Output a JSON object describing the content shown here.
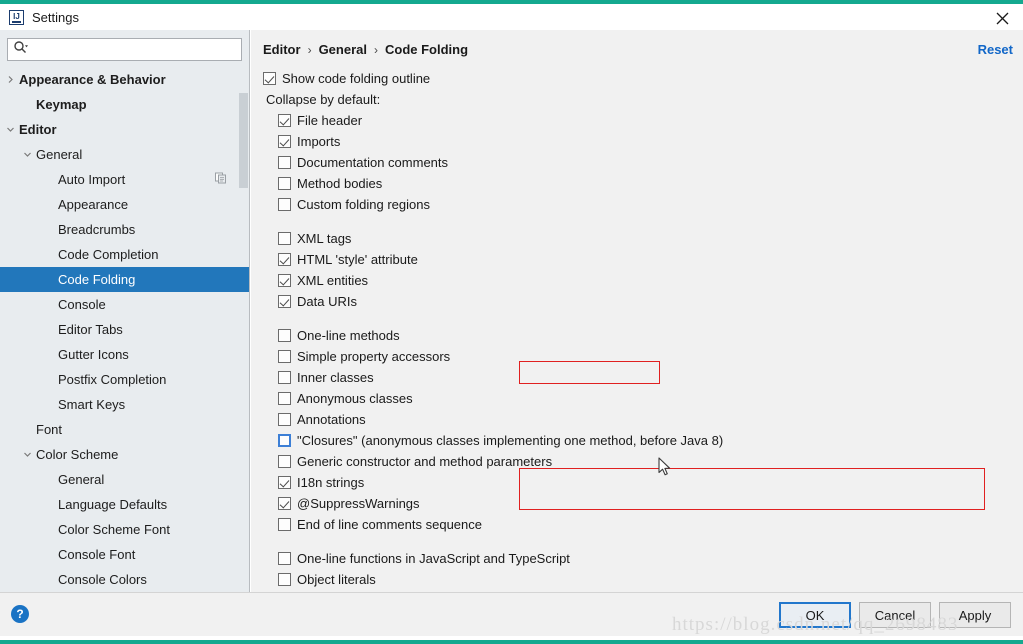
{
  "window": {
    "title": "Settings",
    "logo_icon": "intellij-idea-logo",
    "close_icon": "close-icon"
  },
  "sidebar": {
    "search": {
      "value": "",
      "placeholder": "",
      "icon": "search-icon"
    },
    "items": [
      {
        "label": "Appearance & Behavior",
        "depth": 0,
        "twisty": "chevron-right",
        "bold": true,
        "selected": false
      },
      {
        "label": "Keymap",
        "depth": 1,
        "twisty": "none",
        "bold": true,
        "selected": false
      },
      {
        "label": "Editor",
        "depth": 0,
        "twisty": "chevron-down",
        "bold": true,
        "selected": false
      },
      {
        "label": "General",
        "depth": 1,
        "twisty": "chevron-down",
        "bold": false,
        "selected": false
      },
      {
        "label": "Auto Import",
        "depth": 2,
        "twisty": "none",
        "bold": false,
        "selected": false,
        "badge": "copy-icon"
      },
      {
        "label": "Appearance",
        "depth": 2,
        "twisty": "none",
        "bold": false,
        "selected": false
      },
      {
        "label": "Breadcrumbs",
        "depth": 2,
        "twisty": "none",
        "bold": false,
        "selected": false
      },
      {
        "label": "Code Completion",
        "depth": 2,
        "twisty": "none",
        "bold": false,
        "selected": false
      },
      {
        "label": "Code Folding",
        "depth": 2,
        "twisty": "none",
        "bold": false,
        "selected": true
      },
      {
        "label": "Console",
        "depth": 2,
        "twisty": "none",
        "bold": false,
        "selected": false
      },
      {
        "label": "Editor Tabs",
        "depth": 2,
        "twisty": "none",
        "bold": false,
        "selected": false
      },
      {
        "label": "Gutter Icons",
        "depth": 2,
        "twisty": "none",
        "bold": false,
        "selected": false
      },
      {
        "label": "Postfix Completion",
        "depth": 2,
        "twisty": "none",
        "bold": false,
        "selected": false
      },
      {
        "label": "Smart Keys",
        "depth": 2,
        "twisty": "none",
        "bold": false,
        "selected": false
      },
      {
        "label": "Font",
        "depth": 1,
        "twisty": "none",
        "bold": false,
        "selected": false
      },
      {
        "label": "Color Scheme",
        "depth": 1,
        "twisty": "chevron-down",
        "bold": false,
        "selected": false
      },
      {
        "label": "General",
        "depth": 2,
        "twisty": "none",
        "bold": false,
        "selected": false
      },
      {
        "label": "Language Defaults",
        "depth": 2,
        "twisty": "none",
        "bold": false,
        "selected": false
      },
      {
        "label": "Color Scheme Font",
        "depth": 2,
        "twisty": "none",
        "bold": false,
        "selected": false
      },
      {
        "label": "Console Font",
        "depth": 2,
        "twisty": "none",
        "bold": false,
        "selected": false
      },
      {
        "label": "Console Colors",
        "depth": 2,
        "twisty": "none",
        "bold": false,
        "selected": false
      }
    ]
  },
  "content": {
    "breadcrumbs": [
      "Editor",
      "General",
      "Code Folding"
    ],
    "breadcrumb_separator": "›",
    "reset_label": "Reset",
    "show_outline": {
      "label": "Show code folding outline",
      "checked": true
    },
    "collapse_label": "Collapse by default:",
    "groups": [
      {
        "name": "general-folding-group",
        "items": [
          {
            "label": "File header",
            "checked": true
          },
          {
            "label": "Imports",
            "checked": true
          },
          {
            "label": "Documentation comments",
            "checked": false
          },
          {
            "label": "Method bodies",
            "checked": false
          },
          {
            "label": "Custom folding regions",
            "checked": false
          }
        ]
      },
      {
        "name": "markup-folding-group",
        "items": [
          {
            "label": "XML tags",
            "checked": false
          },
          {
            "label": "HTML 'style' attribute",
            "checked": true
          },
          {
            "label": "XML entities",
            "checked": true
          },
          {
            "label": "Data URIs",
            "checked": true
          }
        ]
      },
      {
        "name": "java-folding-group",
        "items": [
          {
            "label": "One-line methods",
            "checked": false,
            "annotated": true
          },
          {
            "label": "Simple property accessors",
            "checked": false
          },
          {
            "label": "Inner classes",
            "checked": false
          },
          {
            "label": "Anonymous classes",
            "checked": false
          },
          {
            "label": "Annotations",
            "checked": false
          },
          {
            "label": "\"Closures\" (anonymous classes implementing one method, before Java 8)",
            "checked": false,
            "focused": true,
            "annotated": true
          },
          {
            "label": "Generic constructor and method parameters",
            "checked": false,
            "annotated": true
          },
          {
            "label": "I18n strings",
            "checked": true
          },
          {
            "label": "@SuppressWarnings",
            "checked": true
          },
          {
            "label": "End of line comments sequence",
            "checked": false
          }
        ]
      },
      {
        "name": "javascript-folding-group",
        "items": [
          {
            "label": "One-line functions in JavaScript and TypeScript",
            "checked": false
          },
          {
            "label": "Object literals",
            "checked": false
          }
        ]
      }
    ]
  },
  "footer": {
    "help_label": "?",
    "buttons": [
      {
        "label": "OK",
        "default": true
      },
      {
        "label": "Cancel",
        "default": false
      },
      {
        "label": "Apply",
        "default": false
      }
    ]
  },
  "watermark": {
    "text": "https://blog.csdn.net/qq_2698483"
  },
  "colors": {
    "accent_teal": "#14a98f",
    "selection_blue": "#2277bb",
    "link_blue": "#1267c8",
    "annotation_red": "#e02020",
    "sidebar_bg": "#e8ecef",
    "panel_bg": "#f1f1f1"
  }
}
